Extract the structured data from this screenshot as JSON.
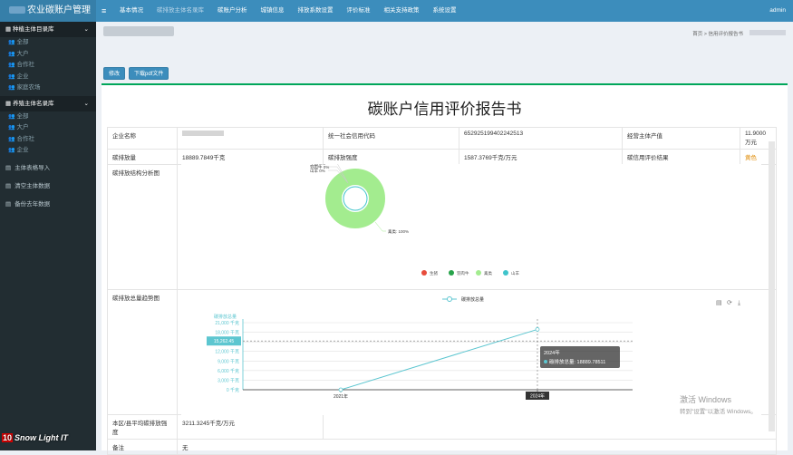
{
  "header": {
    "brand": "农业碳账户管理",
    "nav": [
      "基本情况",
      "碳排放主体名录库",
      "碳账户分析",
      "城镇信息",
      "排放系数设置",
      "评价标准",
      "相关支持政策",
      "系统设置"
    ],
    "user": "admin"
  },
  "sidebar": {
    "group1": "种植主体目录库",
    "group1_items": [
      "全部",
      "大户",
      "合作社",
      "企业",
      "家庭农场"
    ],
    "group2": "养殖主体名录库",
    "group2_items": [
      "全部",
      "大户",
      "合作社",
      "企业"
    ],
    "main_items": [
      "主体表格导入",
      "清空主体数据",
      "备份去年数据"
    ]
  },
  "breadcrumb": {
    "home": "首页",
    "sep": ">",
    "current": "信用评价报告书"
  },
  "buttons": {
    "edit": "修改",
    "download": "下载pdf文件"
  },
  "report": {
    "title": "碳账户信用评价报告书",
    "row1": {
      "l1": "企业名称",
      "l2": "统一社会信用代码",
      "v2": "652925199402242513",
      "l3": "经营主体产值",
      "v3": "11.9000 万元"
    },
    "row2": {
      "l1": "碳排放量",
      "v1": "18889.7849千克",
      "l2": "碳排放强度",
      "v2": "1587.3769千克/万元",
      "l3": "碳信用评价结果",
      "v3": "黄色"
    },
    "structure_label": "碳排放结构分析图",
    "trend_label": "碳排放总量趋势图",
    "avg_label": "本区/县平均碳排放强度",
    "avg_value": "3211.3245千克/万元",
    "remark_label": "备注",
    "remark_value": "无"
  },
  "pie": {
    "slices": [
      {
        "name": "生猪",
        "value": 0,
        "pct": "0%",
        "color": "#e74c3c"
      },
      {
        "name": "羽肉牛",
        "value": 0,
        "pct": "0%",
        "color": "#27a34a"
      },
      {
        "name": "禽类",
        "value": 100,
        "pct": "100%",
        "color": "#a3ec8f"
      },
      {
        "name": "山羊",
        "value": 0,
        "pct": "0%",
        "color": "#3fc4cb"
      }
    ]
  },
  "chart_data": {
    "type": "line",
    "legend": "碳排放总量",
    "ylabel": "碳排放总量",
    "x": [
      "2021年",
      "2024年"
    ],
    "series": [
      {
        "name": "碳排放总量",
        "values": [
          0,
          18889.78511
        ]
      }
    ],
    "yticks": [
      "0 千克",
      "3,000 千克",
      "6,000 千克",
      "9,000 千克",
      "12,000 千克",
      "15,000 千克",
      "18,000 千克",
      "21,000 千克"
    ],
    "ylim": [
      0,
      21000
    ],
    "crosshair_label": "15,262.45",
    "tooltip": {
      "title": "2024年",
      "text": "碳排放总量: 18889.78511"
    },
    "color": "#5cc6d0"
  },
  "watermark": {
    "line1": "激活 Windows",
    "line2": "转到\"设置\"以激活 Windows。"
  },
  "logo": {
    "num": "10",
    "text": "Snow Light IT"
  }
}
